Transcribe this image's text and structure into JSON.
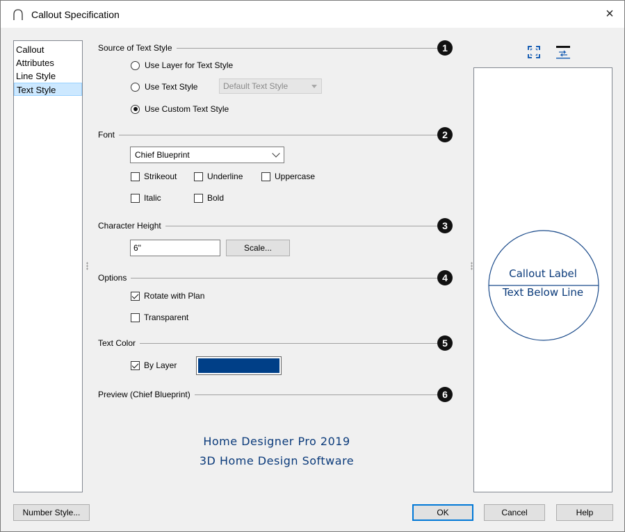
{
  "window": {
    "title": "Callout Specification",
    "close_glyph": "×"
  },
  "nav": {
    "items": [
      {
        "label": "Callout",
        "selected": false
      },
      {
        "label": "Attributes",
        "selected": false
      },
      {
        "label": "Line Style",
        "selected": false
      },
      {
        "label": "Text Style",
        "selected": true
      }
    ]
  },
  "sections": {
    "source": {
      "label": "Source of Text Style",
      "badge": "1",
      "options": {
        "use_layer": "Use Layer for Text Style",
        "use_text_style": "Use Text Style",
        "use_custom": "Use Custom Text Style"
      },
      "selected": "use_custom",
      "text_style_value": "Default Text Style"
    },
    "font": {
      "label": "Font",
      "badge": "2",
      "font_value": "Chief Blueprint",
      "strikeout": "Strikeout",
      "underline": "Underline",
      "uppercase": "Uppercase",
      "italic": "Italic",
      "bold": "Bold"
    },
    "height": {
      "label": "Character Height",
      "badge": "3",
      "value": "6\"",
      "scale_button": "Scale..."
    },
    "options": {
      "label": "Options",
      "badge": "4",
      "rotate": "Rotate with Plan",
      "rotate_checked": true,
      "transparent": "Transparent",
      "transparent_checked": false
    },
    "color": {
      "label": "Text Color",
      "badge": "5",
      "by_layer": "By Layer",
      "by_layer_checked": true,
      "swatch_color": "#003f87"
    },
    "preview": {
      "label": "Preview (Chief Blueprint)",
      "badge": "6",
      "line1": "Home Designer Pro 2019",
      "line2": "3D Home Design Software"
    }
  },
  "right_preview": {
    "label_top": "Callout Label",
    "label_bottom": "Text Below Line",
    "icons": [
      "fill-window-icon",
      "swap-text-icon"
    ]
  },
  "footer": {
    "number_style": "Number Style...",
    "ok": "OK",
    "cancel": "Cancel",
    "help": "Help"
  }
}
